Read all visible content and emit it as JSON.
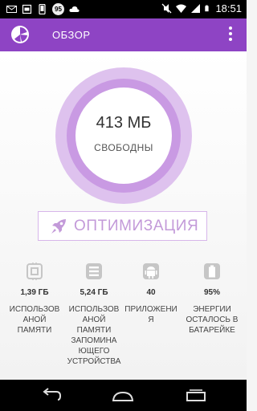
{
  "status_bar": {
    "time": "18:51",
    "notification_badge": "95",
    "icons": [
      "email-icon",
      "screenshot-icon",
      "phone-icon",
      "notification-badge",
      "cloud-icon",
      "mute-icon",
      "wifi-icon",
      "signal-icon",
      "battery-icon"
    ]
  },
  "app_bar": {
    "title": "ОБЗОР",
    "logo_icon": "pie-chart-logo-icon",
    "menu_icon": "overflow-menu-icon"
  },
  "memory": {
    "value": "413 МБ",
    "label": "СВОБОДНЫ"
  },
  "optimize_button": {
    "label": "ОПТИМИЗАЦИЯ",
    "icon": "rocket-icon"
  },
  "stats": [
    {
      "icon": "chip-icon",
      "value": "1,39 ГБ",
      "label": "ИСПОЛЬЗОВ АНОЙ ПАМЯТИ"
    },
    {
      "icon": "storage-icon",
      "value": "5,24 ГБ",
      "label": "ИСПОЛЬЗОВ АНОЙ ПАМЯТИ ЗАПОМИНА ЮЩЕГО УСТРОЙСТВА"
    },
    {
      "icon": "android-icon",
      "value": "40",
      "label": "ПРИЛОЖЕНИ Я"
    },
    {
      "icon": "battery-icon",
      "value": "95%",
      "label": "ЭНЕРГИИ ОСТАЛОСЬ В БАТАРЕЙКЕ"
    }
  ],
  "colors": {
    "accent": "#8e44c4",
    "ring_outer": "#dec2ee",
    "ring_mid": "#c99ae3",
    "button_text": "#c39ad9"
  },
  "nav_bar": {
    "buttons": [
      "back-icon",
      "home-icon",
      "recents-icon"
    ]
  }
}
